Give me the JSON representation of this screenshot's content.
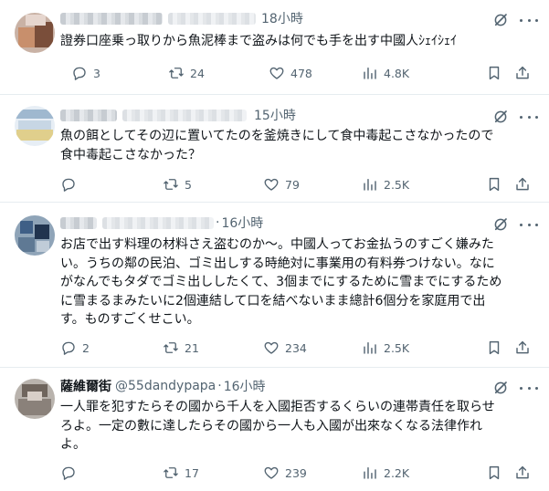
{
  "posts": [
    {
      "time": "18小時",
      "lines": [
        "證券口座乗っ取りから魚泥棒まで盗みは何でも手を出す中國人ｼｪｲｼｪｲ"
      ],
      "replies": "3",
      "reposts": "24",
      "likes": "478",
      "views": "4.8K"
    },
    {
      "time": "15小時",
      "lines": [
        "魚の餌としてその辺に置いてたのを釜焼きにして食中毒起こさなかったので",
        "食中毒起こさなかった？"
      ],
      "replies": "",
      "reposts": "5",
      "likes": "79",
      "views": "2.5K"
    },
    {
      "time": "16小時",
      "lines": [
        "お店で出す料理の材料さえ盗むのか〜。中國人ってお金払うのすごく嫌みた",
        "い。うちの鄰の民泊、ゴミ出しする時絶対に事業用の有料券つけない。なに",
        "がなんでもタダでゴミ出ししたくて、3個までにするために雪までにするため",
        "に雪まるまみたいに2個連結して口を結べないまま總計6個分を家庭用で出",
        "す。ものすごくせこい。"
      ],
      "replies": "2",
      "reposts": "21",
      "likes": "234",
      "views": "2.5K"
    },
    {
      "name": "薩維爾街",
      "handle": "@55dandypapa",
      "time": "16小時",
      "lines": [
        "一人罪を犯すたらその國から千人を入國拒否するくらいの連帯責任を取らせ",
        "ろよ。一定の數に達したらその國から一人も入國が出來なくなる法律作れ",
        "よ。"
      ],
      "replies": "",
      "reposts": "17",
      "likes": "239",
      "views": "2.2K"
    }
  ],
  "separator": "·",
  "icons": {
    "reply": "reply-icon",
    "repost": "repost-icon",
    "like": "heart-icon",
    "views": "views-icon",
    "bookmark": "bookmark-icon",
    "share": "share-icon",
    "grok": "grok-icon",
    "more": "more-icon"
  },
  "colors": {
    "muted": "#536471",
    "text": "#0f1419",
    "divider": "#e6ecf0"
  }
}
